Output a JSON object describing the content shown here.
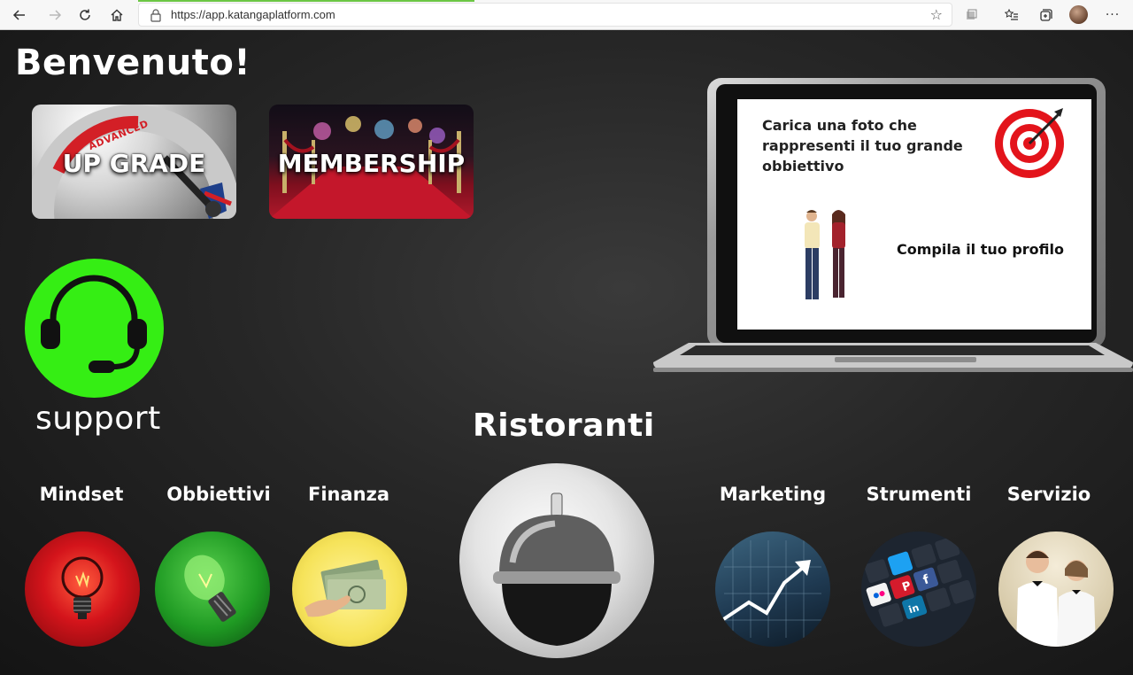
{
  "browser": {
    "url": "https://app.katangaplatform.com"
  },
  "page": {
    "welcome": "Benvenuto!",
    "promo_cards": {
      "upgrade": "UP GRADE",
      "upgrade_badge": "ADVANCED",
      "membership": "MEMBERSHIP"
    },
    "support": "support",
    "laptop": {
      "photo_prompt": "Carica una foto che rappresenti il tuo grande obbiettivo",
      "profile_prompt": "Compila il tuo profilo"
    },
    "featured": {
      "title": "Ristoranti"
    },
    "categories": [
      {
        "label": "Mindset",
        "icon": "lightbulb-red-icon",
        "color": "#e3141b"
      },
      {
        "label": "Obbiettivi",
        "icon": "lightbulb-green-icon",
        "color": "#1f9a23"
      },
      {
        "label": "Finanza",
        "icon": "money-hand-icon",
        "color": "#f6e35a"
      },
      {
        "label": "Marketing",
        "icon": "growth-chart-icon",
        "color": "#2a4a62"
      },
      {
        "label": "Strumenti",
        "icon": "social-keyboard-icon",
        "color": "#1d2530"
      },
      {
        "label": "Servizio",
        "icon": "waiters-icon",
        "color": "#d6c9a8"
      }
    ]
  },
  "colors": {
    "support_green": "#35ee14",
    "target_red": "#e3141b",
    "accent_load": "#6cc644"
  }
}
